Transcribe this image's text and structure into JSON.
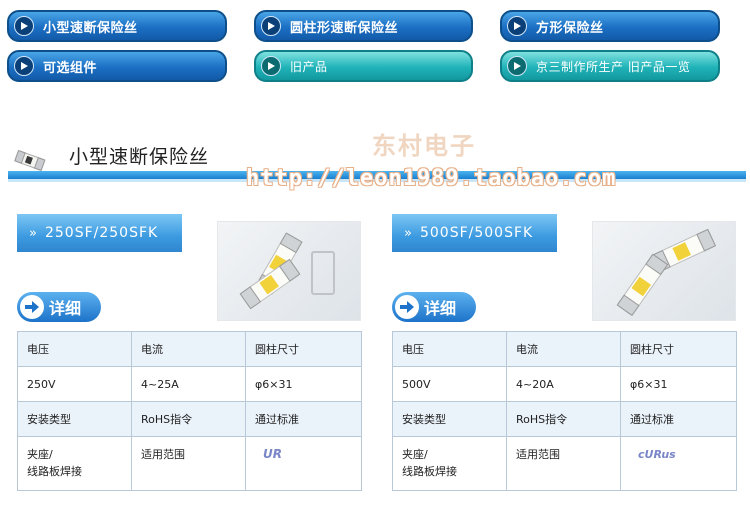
{
  "nav": [
    {
      "label": "小型速断保险丝",
      "style": "blue"
    },
    {
      "label": "圆柱形速断保险丝",
      "style": "blue"
    },
    {
      "label": "方形保险丝",
      "style": "blue"
    },
    {
      "label": "可选组件",
      "style": "blue"
    },
    {
      "label": "旧产品",
      "style": "teal"
    },
    {
      "label": "京三制作所生产 旧产品一览",
      "style": "teal"
    }
  ],
  "section": {
    "title": "小型速断保险丝"
  },
  "watermark": {
    "shop": "东村电子",
    "url": "http://leon1989.taobao.com"
  },
  "products": [
    {
      "name": "250SF/250SFK",
      "detail_label": "详细",
      "spec": {
        "header1": [
          "电压",
          "电流",
          "圆柱尺寸"
        ],
        "row1": [
          "250V",
          "4~25A",
          "φ6×31"
        ],
        "header2": [
          "安装类型",
          "RoHS指令",
          "通过标准"
        ],
        "row2_mount": "夹座/\n线路板焊接",
        "row2_scope": "适用范围",
        "cert": "UR"
      }
    },
    {
      "name": "500SF/500SFK",
      "detail_label": "详细",
      "spec": {
        "header1": [
          "电压",
          "电流",
          "圆柱尺寸"
        ],
        "row1": [
          "500V",
          "4~20A",
          "φ6×31"
        ],
        "header2": [
          "安装类型",
          "RoHS指令",
          "通过标准"
        ],
        "row2_mount": "夹座/\n线路板焊接",
        "row2_scope": "适用范围",
        "cert": "cURus"
      }
    }
  ],
  "colors": {
    "accent": "#1b6fc4",
    "teal": "#1fb3b8",
    "table_border": "#b9c8d6",
    "header_bg": "#eaf2fa"
  }
}
